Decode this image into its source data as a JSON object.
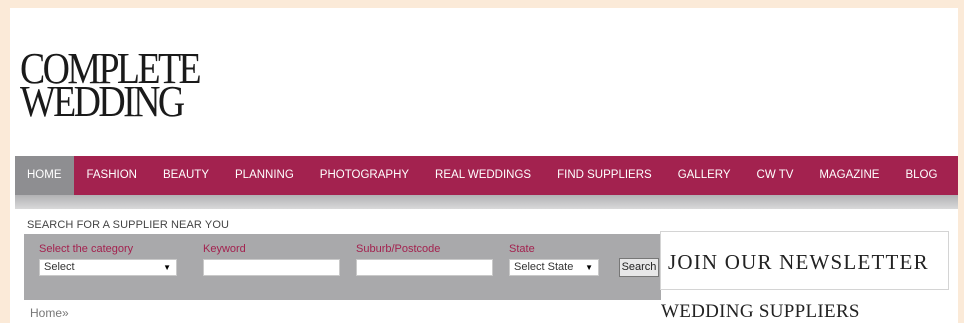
{
  "logo": {
    "line1": "COMPLETE",
    "line2": "WEDDING"
  },
  "nav": {
    "items": [
      {
        "label": "HOME"
      },
      {
        "label": "FASHION"
      },
      {
        "label": "BEAUTY"
      },
      {
        "label": "PLANNING"
      },
      {
        "label": "PHOTOGRAPHY"
      },
      {
        "label": "REAL WEDDINGS"
      },
      {
        "label": "FIND SUPPLIERS"
      },
      {
        "label": "GALLERY"
      },
      {
        "label": "CW TV"
      },
      {
        "label": "MAGAZINE"
      },
      {
        "label": "BLOG"
      }
    ],
    "active_index": 0,
    "colors": {
      "bar": "#a3224f",
      "active": "#8e8e91"
    }
  },
  "search": {
    "title": "SEARCH FOR A SUPPLIER NEAR YOU",
    "category_label": "Select the category",
    "category_value": "Select",
    "keyword_label": "Keyword",
    "keyword_value": "",
    "suburb_label": "Suburb/Postcode",
    "suburb_value": "",
    "state_label": "State",
    "state_value": "Select State",
    "button_label": "Search"
  },
  "breadcrumb": {
    "home": "Home",
    "separator": "»"
  },
  "sidebar": {
    "newsletter_label": "JOIN OUR NEWSLETTER",
    "suppliers_heading": "WEDDING SUPPLIERS"
  }
}
